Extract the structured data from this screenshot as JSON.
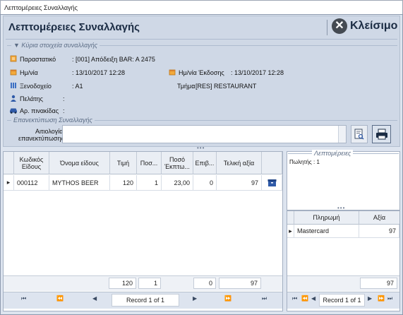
{
  "window": {
    "title": "Λεπτομέρειες Συναλλαγής"
  },
  "header": {
    "title": "Λεπτομέρειες Συναλλαγής",
    "close_label": "Κλείσιμο"
  },
  "main_group": {
    "label": "Κύρια στοιχεία συναλλαγής",
    "fields": {
      "voucher_label": "Παραστατικό",
      "voucher_value": ": [001] Απόδειξη BAR: A 2475",
      "date_label": "Ημ/νία",
      "date_value": ": 13/10/2017 12:28",
      "issue_date_label": "Ημ/νία Έκδοσης",
      "issue_date_value": ": 13/10/2017 12:28",
      "hotel_label": "Ξενοδοχείο",
      "hotel_value": ": A1",
      "dept_label": "Τμήμα",
      "dept_value": ": [RES] RESTAURANT",
      "customer_label": "Πελάτης",
      "customer_value": ":",
      "plate_label": "Αρ. πινακίδας",
      "plate_value": ":"
    }
  },
  "reprint_group": {
    "label": "Επανεκτύπωση Συναλλαγής",
    "reason_label_1": "Αιτιολογία",
    "reason_label_2": "επανεκτύπωσης"
  },
  "items_grid": {
    "columns": [
      "Κωδικός Είδους",
      "Όνομα είδους",
      "Τιμή",
      "Ποσ...",
      "Ποσό Έκπτω...",
      "Επιβ...",
      "Τελική αξία"
    ],
    "rows": [
      {
        "code": "000112",
        "name": "MYTHOS BEER",
        "price": "120",
        "qty": "1",
        "discount": "23,00",
        "surcharge": "0",
        "total": "97"
      }
    ],
    "totals": {
      "price": "120",
      "qty": "1",
      "surcharge": "0",
      "total": "97"
    },
    "record_text": "Record 1 of 1"
  },
  "details_panel": {
    "label": "Λεπτομέρειες",
    "text": "Πωλητής : 1"
  },
  "payments_grid": {
    "columns": [
      "Πληρωμή",
      "Αξία"
    ],
    "rows": [
      {
        "method": "Mastercard",
        "amount": "97"
      }
    ],
    "total": "97",
    "record_text": "Record 1 of 1"
  },
  "colors": {
    "accent": "#1b2c44",
    "panel": "#cfd8e6"
  }
}
